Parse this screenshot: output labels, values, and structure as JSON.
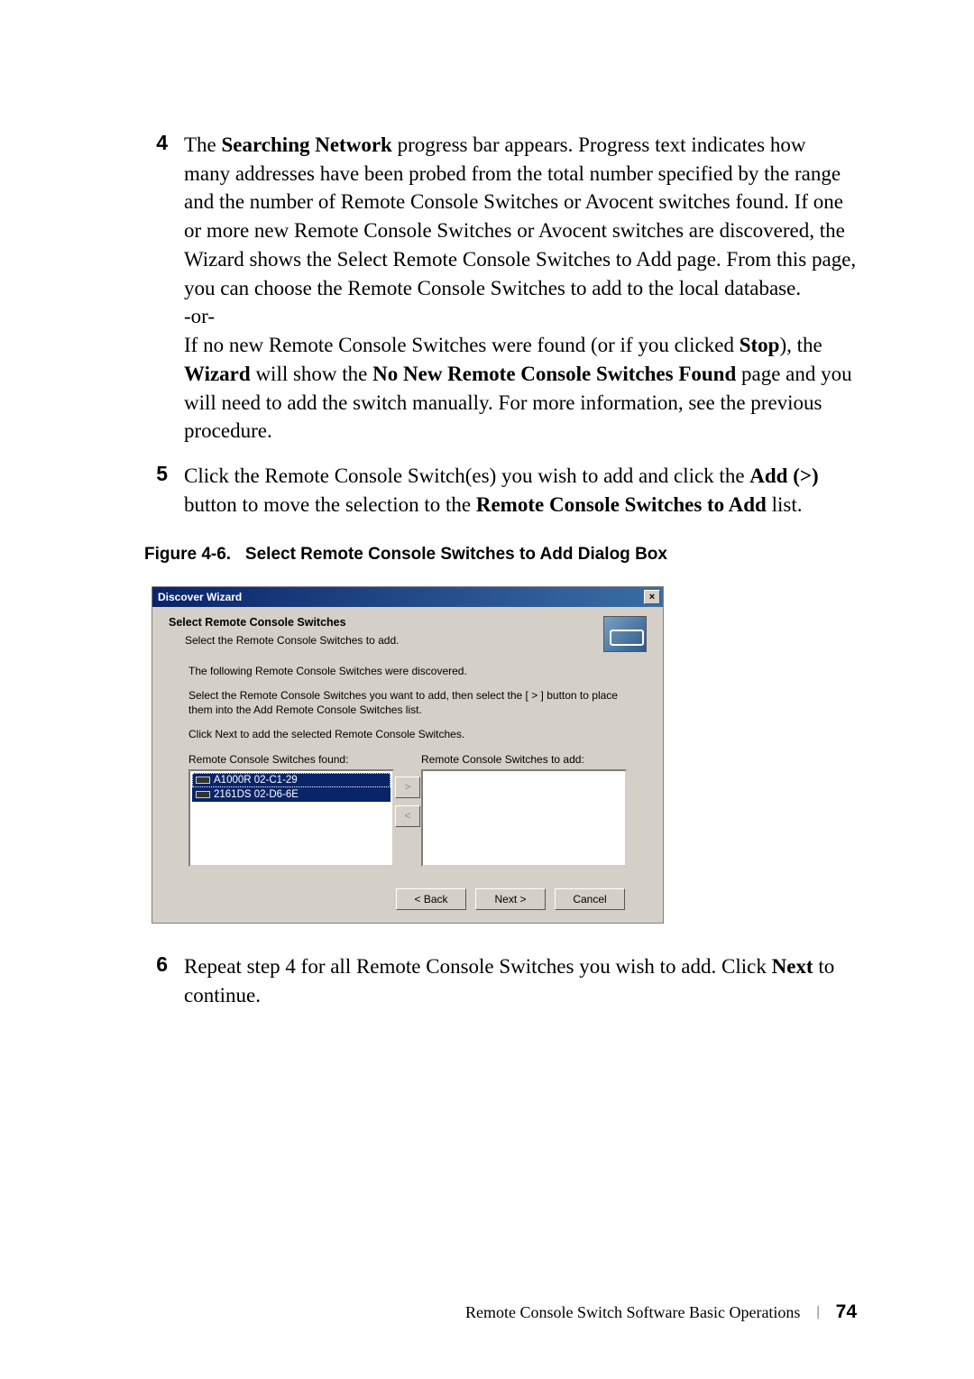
{
  "steps": {
    "s4": {
      "num": "4",
      "p1a": "The ",
      "p1b": "Searching Network",
      "p1c": " progress bar appears. Progress text indicates how many addresses have been probed from the total number specified by the range and the number of Remote Console Switches or Avocent switches found. If one or more new Remote Console Switches or Avocent switches are discovered, the Wizard shows the Select Remote Console Switches to Add page. From this page, you can choose the Remote Console Switches to add to the local database.",
      "or": "-or-",
      "p2a": "If no new Remote Console Switches were found (or if you clicked ",
      "p2b": "Stop",
      "p2c": "), the ",
      "p2d": "Wizard",
      "p2e": " will show the ",
      "p2f": "No New Remote Console Switches Found",
      "p2g": " page and you will need to add the switch manually. For more information, see the previous procedure."
    },
    "s5": {
      "num": "5",
      "p1a": "Click the Remote Console Switch(es) you wish to add and click the ",
      "p1b": "Add (>)",
      "p1c": " button to move the selection to the ",
      "p1d": "Remote Console Switches to Add",
      "p1e": " list."
    },
    "s6": {
      "num": "6",
      "p1a": "Repeat step 4 for all Remote Console Switches you wish to add. Click ",
      "p1b": "Next",
      "p1c": " to continue."
    }
  },
  "figure": {
    "label": "Figure 4-6.",
    "title": "Select Remote Console Switches to Add Dialog Box"
  },
  "dialog": {
    "title": "Discover Wizard",
    "close": "×",
    "headerTitle": "Select Remote Console Switches",
    "headerSub": "Select the Remote Console Switches to add.",
    "p1": "The following Remote Console Switches were discovered.",
    "p2": "Select the Remote Console Switches you want to add, then select the [ > ] button to place them into the Add Remote Console Switches list.",
    "p3": "Click Next to add the selected Remote Console Switches.",
    "foundLabel": "Remote Console Switches found:",
    "addLabel": "Remote Console Switches to add:",
    "items": {
      "i0": "A1000R 02-C1-29",
      "i1": "2161DS 02-D6-6E"
    },
    "btnAdd": ">",
    "btnRemove": "<",
    "back": "< Back",
    "next": "Next >",
    "cancel": "Cancel"
  },
  "footer": {
    "title": "Remote Console Switch Software Basic Operations",
    "sep": "|",
    "page": "74"
  }
}
